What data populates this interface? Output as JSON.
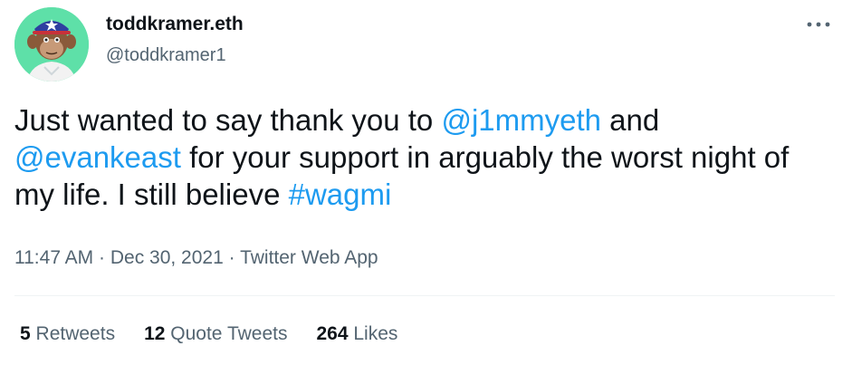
{
  "user": {
    "display_name": "toddkramer.eth",
    "handle": "@toddkramer1",
    "avatar_icon": "ape-avatar-icon"
  },
  "menu": {
    "icon": "more-horizontal-icon"
  },
  "tweet": {
    "text_1": "Just wanted to say thank you to ",
    "mention_1": "@j1mmyeth",
    "text_2": " and ",
    "mention_2": "@evankeast",
    "text_3": " for your support in arguably the worst night of my life. I still believe ",
    "hashtag": "#wagmi"
  },
  "meta": {
    "time": "11:47 AM",
    "separator": " · ",
    "date": "Dec 30, 2021",
    "source": "Twitter Web App"
  },
  "stats": {
    "retweets_count": "5",
    "retweets_label": "Retweets",
    "quotes_count": "12",
    "quotes_label": "Quote Tweets",
    "likes_count": "264",
    "likes_label": "Likes"
  },
  "colors": {
    "link": "#1d9bf0",
    "secondary_text": "#536471",
    "avatar_bg": "#5ee0a8"
  }
}
